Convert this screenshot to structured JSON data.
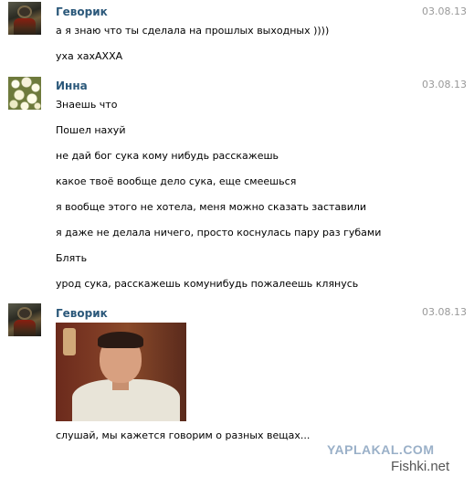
{
  "messages": [
    {
      "author": "Геворик",
      "date": "03.08.13",
      "avatar": "armored-character-avatar",
      "lines": [
        "а я знаю что ты сделала на прошлых выходных ))))",
        "уха хахАХХА"
      ]
    },
    {
      "author": "Инна",
      "date": "03.08.13",
      "avatar": "flowers-avatar",
      "lines": [
        "Знаешь что",
        "Пошел нахуй",
        "не дай бог сука кому нибудь расскажешь",
        "какое твоё вообще дело сука, еще смеешься",
        "я вообще этого не хотела, меня можно сказать заставили",
        "я даже не делала ничего, просто коснулась пару раз губами",
        "Блять",
        "урод сука, расскажешь комунибудь пожалеешь клянусь"
      ]
    },
    {
      "author": "Геворик",
      "date": "03.08.13",
      "avatar": "armored-character-avatar",
      "attachment": "photo-man-in-white-shirt",
      "lines": [
        "слушай, мы кажется говорим о разных вещах..."
      ]
    }
  ],
  "watermarks": {
    "yaplakal": "YAPLAKAL.COM",
    "fishki": "Fishki.net"
  }
}
